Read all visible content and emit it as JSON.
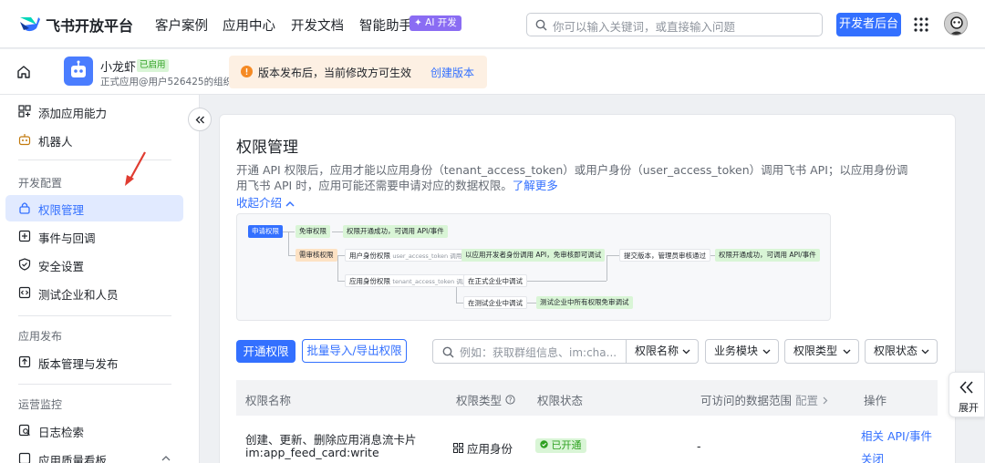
{
  "topbar": {
    "brand": "飞书开放平台",
    "nav": [
      "客户案例",
      "应用中心",
      "开发文档",
      "智能助手"
    ],
    "ai_badge": "✦ AI 开发",
    "search_placeholder": "你可以输入关键词，或直接输入问题",
    "dev_console": "开发者后台"
  },
  "appbar": {
    "app_name": "小龙虾",
    "app_tag": "已启用",
    "app_sub": "正式应用@用户526425的组织",
    "notice_text": "版本发布后，当前修改方可生效",
    "notice_link": "创建版本"
  },
  "sidebar": {
    "top_items": [
      {
        "label": "添加应用能力",
        "icon": "grid-add-icon"
      },
      {
        "label": "机器人",
        "icon": "robot-icon"
      }
    ],
    "group1": "开发配置",
    "group1_items": [
      {
        "label": "权限管理",
        "icon": "lock-icon",
        "active": true
      },
      {
        "label": "事件与回调",
        "icon": "event-icon"
      },
      {
        "label": "安全设置",
        "icon": "shield-icon"
      },
      {
        "label": "测试企业和人员",
        "icon": "code-icon"
      }
    ],
    "group2": "应用发布",
    "group2_items": [
      {
        "label": "版本管理与发布",
        "icon": "upload-icon"
      }
    ],
    "group3": "运营监控",
    "group3_items": [
      {
        "label": "日志检索",
        "icon": "log-search-icon"
      },
      {
        "label": "应用质量看板",
        "icon": "dashboard-icon"
      }
    ]
  },
  "main": {
    "title": "权限管理",
    "desc_line1": "开通 API 权限后，应用才能以应用身份（tenant_access_token）或用户身份（user_access_token）调用飞书 API；以应用身份调",
    "desc_line2": "用飞书 API 时，应用可能还需要申请对应的数据权限。",
    "learn_more": "了解更多",
    "collapse_intro": "收起介绍",
    "diagram": {
      "apply": "申请权限",
      "exempt": "免审权限",
      "exempt_result": "权限开通成功，可调用 API/事件",
      "review": "需审核权限",
      "user_token": "用户身份权限",
      "user_token_note": "user_access_token 调用",
      "dev_call": "以应用开发者身份调用 API，免审核即可调试",
      "submit": "提交版本，管理员审核通过",
      "final_result": "权限开通成功，可调用 API/事件",
      "app_token": "应用身份权限",
      "app_token_note": "tenant_access_token 调用",
      "formal_debug": "在正式企业中调试",
      "test_debug": "在测试企业中调试",
      "test_all": "测试企业中所有权限免审调试"
    },
    "enable_btn": "开通权限",
    "bulk_btn": "批量导入/导出权限",
    "perm_search_placeholder": "例如：获取群组信息、im:cha...",
    "filters": [
      "权限名称",
      "业务模块",
      "权限类型",
      "权限状态"
    ],
    "table": {
      "headers": [
        "权限名称",
        "权限类型",
        "权限状态",
        "可访问的数据范围",
        "配置",
        "操作"
      ],
      "rows": [
        {
          "name": "创建、更新、删除应用消息流卡片",
          "code": "im:app_feed_card:write",
          "type": "应用身份",
          "status": "已开通",
          "scope": "-",
          "action1": "相关 API/事件",
          "action2": "关闭"
        }
      ]
    }
  },
  "expand_label": "展开"
}
